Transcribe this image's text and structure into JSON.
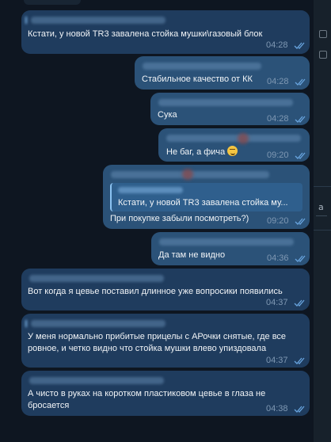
{
  "messages": [
    {
      "text": "Кстати, у новой TR3 завалена стойка мушки\\газовый блок",
      "time": "04:28"
    },
    {
      "text": "Стабильное качество от КК",
      "time": "04:28"
    },
    {
      "text": "Сука",
      "time": "04:28"
    },
    {
      "text": "Не баг, а фича",
      "time": "09:20"
    },
    {
      "quote": "Кстати, у новой TR3 завалена стойка му...",
      "text": "При покупке забыли посмотреть?)",
      "time": "09:20"
    },
    {
      "text": "Да там не видно",
      "time": "04:36"
    },
    {
      "text": "Вот когда я цевье поставил длинное уже вопросики появились",
      "time": "04:37"
    },
    {
      "text": "У меня нормально прибитые прицелы с АРочки снятые, где все ровное, и четко видно что стойка мушки влево упизд​овала",
      "time": "04:37"
    },
    {
      "text": "А чисто в руках на коротком пластиковом цевье в глаза не бросается",
      "time": "04:38"
    }
  ],
  "right_panel": {
    "label": "a"
  },
  "colors": {
    "background": "#0e1621",
    "bubble_out": "#2b5278",
    "bubble_in": "#1f3c5e",
    "meta": "#7f98b3",
    "check": "#68a4de"
  },
  "icons": [
    "double-check-icon",
    "rofl-emoji-icon"
  ]
}
